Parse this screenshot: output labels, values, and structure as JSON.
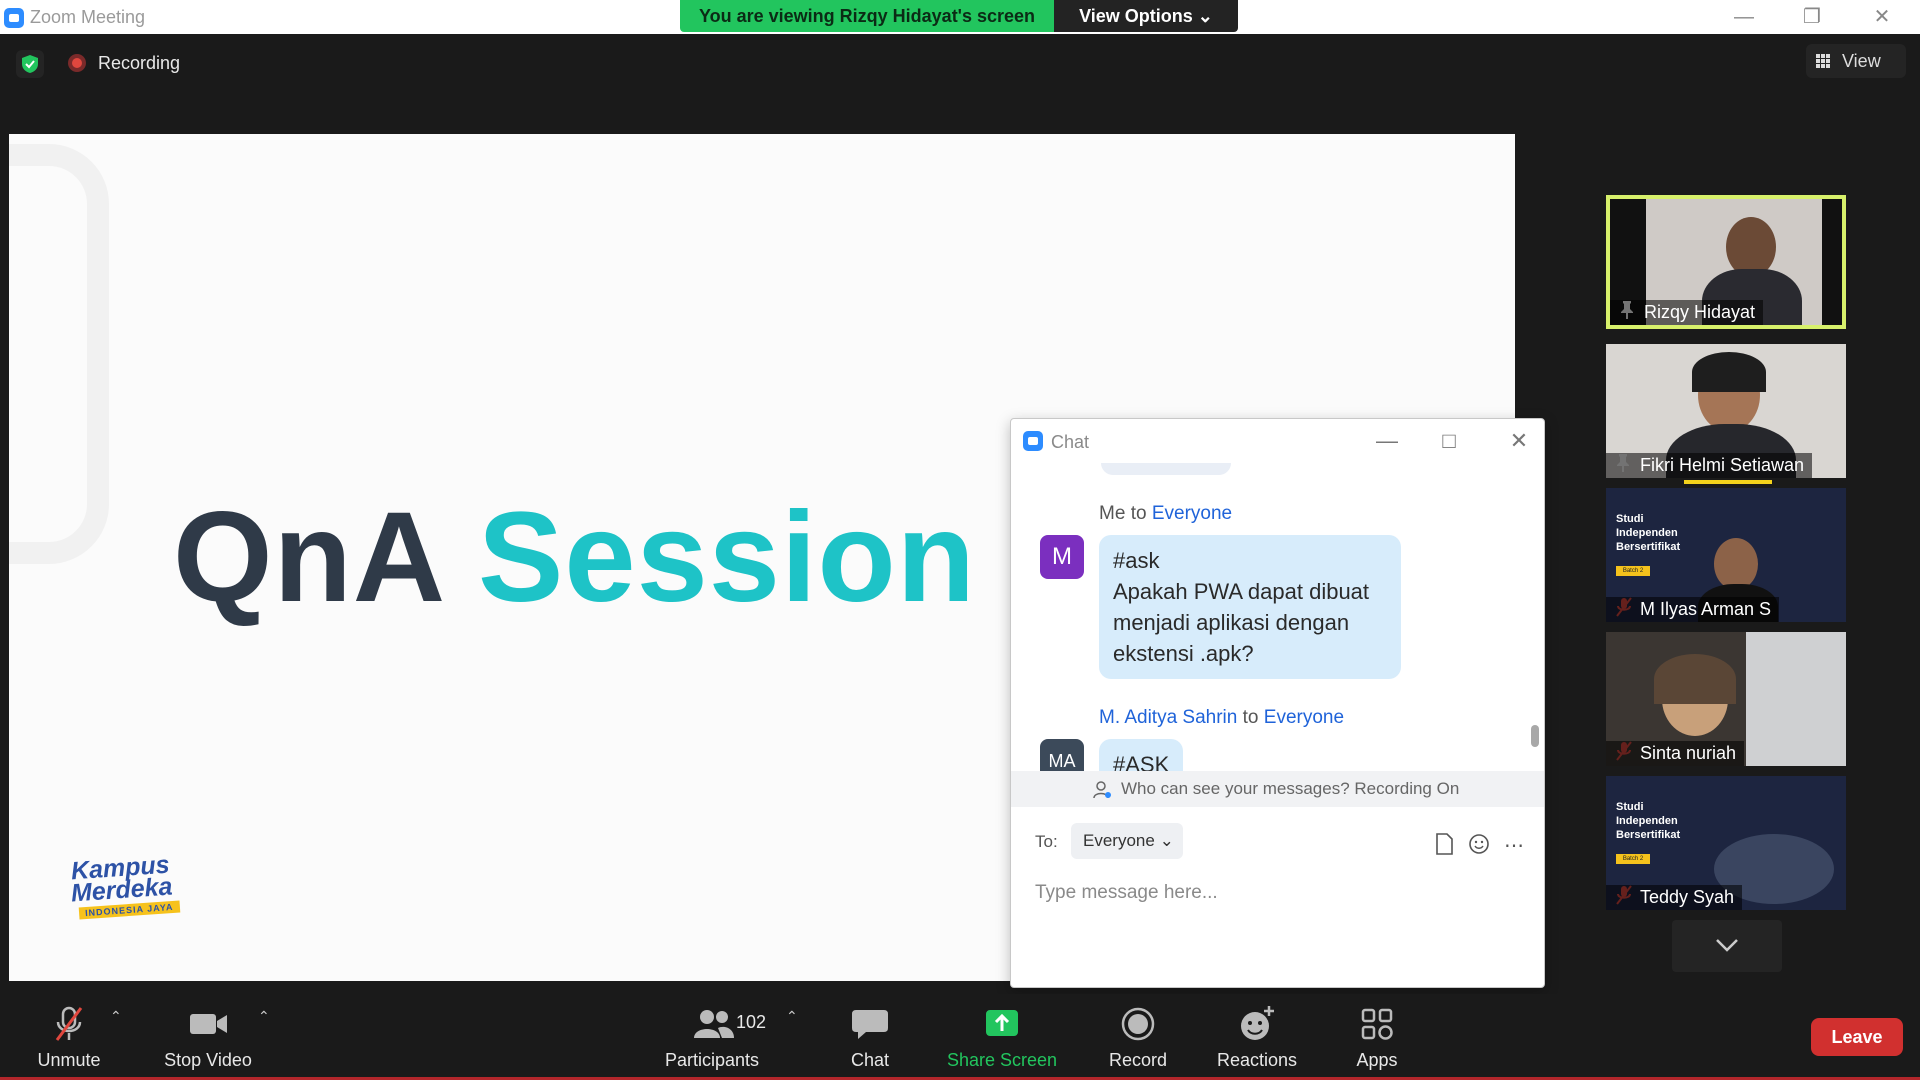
{
  "window": {
    "title": "Zoom Meeting"
  },
  "banner": {
    "viewing_text": "You are viewing Rizqy Hidayat's screen",
    "view_options_label": "View Options"
  },
  "topbar": {
    "recording_label": "Recording",
    "view_label": "View"
  },
  "shared_screen": {
    "title_dark": "QnA",
    "title_accent": "Session",
    "logo_line1": "Kampus",
    "logo_line2": "Merdeka",
    "logo_tagline": "INDONESIA JAYA"
  },
  "chat": {
    "title": "Chat",
    "messages": [
      {
        "sender": "Me",
        "to_word": "to",
        "recipient": "Everyone",
        "avatar": "M",
        "avatar_color": "#7b2fbf",
        "text_line1": "#ask",
        "text_rest": "Apakah PWA dapat dibuat menjadi aplikasi dengan ekstensi .apk?"
      },
      {
        "sender": "M. Aditya Sahrin",
        "to_word": "to",
        "recipient": "Everyone",
        "avatar": "MA",
        "avatar_color": "#3c4a5a",
        "text_line1": "#ASK"
      }
    ],
    "notice": "Who can see your messages? Recording On",
    "to_label": "To:",
    "to_value": "Everyone",
    "input_placeholder": "Type message here..."
  },
  "participants_panel": [
    {
      "name": "Rizqy Hidayat",
      "status": "pinned",
      "active_speaker": true
    },
    {
      "name": "Fikri Helmi Setiawan",
      "status": "pinned"
    },
    {
      "name": "M Ilyas Arman S",
      "status": "muted",
      "background": "Studi Independen Bersertifikat"
    },
    {
      "name": "Sinta nuriah",
      "status": "muted"
    },
    {
      "name": "Teddy Syah",
      "status": "muted",
      "background": "Studi Independen Bersertifikat"
    }
  ],
  "studi": {
    "l1": "Studi",
    "l2": "Independen",
    "l3": "Bersertifikat",
    "batch": "Batch 2"
  },
  "toolbar": {
    "unmute": "Unmute",
    "stop_video": "Stop Video",
    "participants": "Participants",
    "participant_count": "102",
    "chat": "Chat",
    "share_screen": "Share Screen",
    "record": "Record",
    "reactions": "Reactions",
    "apps": "Apps",
    "leave": "Leave"
  },
  "colors": {
    "accent_green": "#22c55e",
    "share_green": "#22c55e",
    "leave_red": "#d1302f",
    "speaker_border": "#d7f06b",
    "qna_dark": "#2f3a48",
    "qna_teal": "#1ec3c7"
  }
}
